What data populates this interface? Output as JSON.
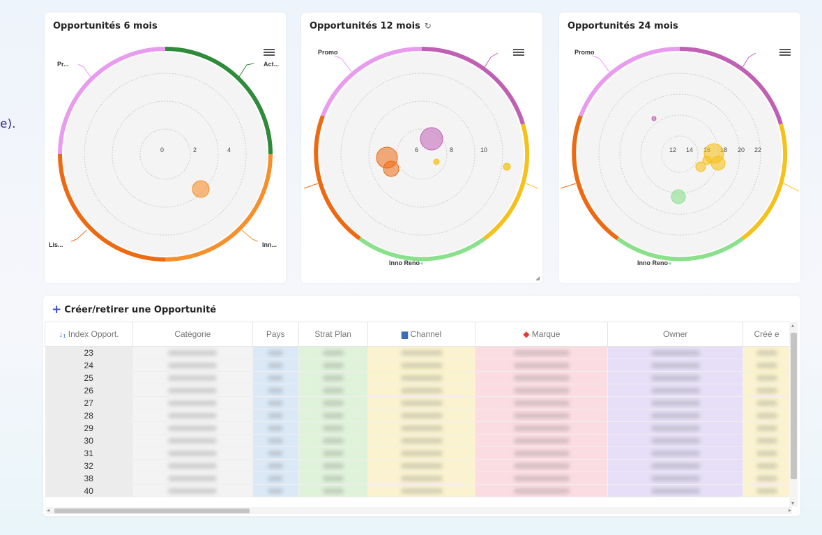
{
  "edge_text": "e).",
  "charts": [
    {
      "title": "Opportunités 6 mois",
      "refresh_icon": "",
      "labels": {
        "tl": "Pr...",
        "tr": "Act...",
        "bl": "Lis...",
        "br": "Inn...",
        "bottom": ""
      },
      "ring_labels": [
        "0",
        "2",
        "4"
      ],
      "colors": {
        "a": "#e89bef",
        "b": "#2e8b3a",
        "c": "#f6902c",
        "d": "#ee6a12"
      }
    },
    {
      "title": "Opportunités 12 mois",
      "refresh_icon": "↻",
      "labels": {
        "tl": "Promo",
        "tr": "",
        "bl": "",
        "br": "",
        "bottom": "Inno Reno"
      },
      "ring_labels": [
        "6",
        "8",
        "10"
      ],
      "colors": {
        "a": "#e89bef",
        "b": "#c060b4",
        "c": "#f5c11c",
        "d": "#8be08c",
        "e": "#ee6a12"
      }
    },
    {
      "title": "Opportunités 24 mois",
      "refresh_icon": "",
      "labels": {
        "tl": "Promo",
        "tr": "",
        "bl": "",
        "br": "",
        "bottom": "Inno Reno"
      },
      "ring_labels": [
        "12",
        "14",
        "16",
        "18",
        "20",
        "22"
      ],
      "colors": {
        "a": "#e89bef",
        "b": "#c060b4",
        "c": "#f5c11c",
        "d": "#8be08c",
        "e": "#ee6a12"
      }
    }
  ],
  "table": {
    "create_label": "Créer/retirer une Opportunité",
    "columns": [
      "Index Opport.",
      "Catégorie",
      "Pays",
      "Strat Plan",
      "Channel",
      "Marque",
      "Owner",
      "Créé e"
    ],
    "sort_icon": "↓₁",
    "rows": [
      "23",
      "24",
      "25",
      "26",
      "27",
      "28",
      "29",
      "30",
      "31",
      "32",
      "38",
      "40"
    ],
    "column_colors": [
      "#ececec",
      "#f3f3f3",
      "#dbe9f7",
      "#dff2da",
      "#fbf3cf",
      "#fbdce2",
      "#e6dff7",
      "#fbf3cf"
    ]
  }
}
